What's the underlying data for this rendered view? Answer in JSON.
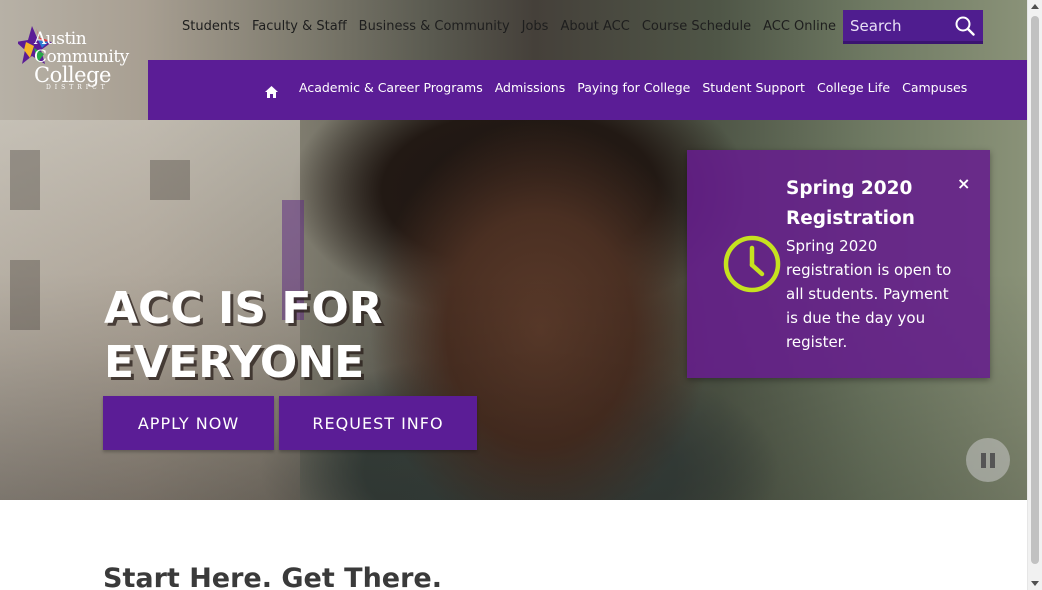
{
  "logo": {
    "line1": "Austin",
    "line2": "Community",
    "line3": "College",
    "line4": "DISTRICT"
  },
  "utility_nav": [
    "Students",
    "Faculty & Staff",
    "Business & Community",
    "Jobs",
    "About ACC",
    "Course Schedule",
    "ACC Online"
  ],
  "search": {
    "placeholder": "Search"
  },
  "main_nav": [
    "Academic & Career Programs",
    "Admissions",
    "Paying for College",
    "Student Support",
    "College Life",
    "Campuses"
  ],
  "hero": {
    "headline_line1": "ACC IS FOR",
    "headline_line2": "EVERYONE",
    "apply_label": "APPLY NOW",
    "request_label": "REQUEST INFO"
  },
  "alert": {
    "title": "Spring 2020 Registration",
    "body": "Spring 2020 registration is open to all students. Payment is due the day you register.",
    "close_label": "×"
  },
  "tagline": "Start Here. Get There.",
  "colors": {
    "brand_purple": "#5b1d96",
    "accent_lime": "#c6e21f"
  },
  "icons": {
    "home": "home-icon",
    "search": "search-icon",
    "clock": "clock-icon",
    "pause": "pause-icon",
    "close": "close-icon"
  }
}
